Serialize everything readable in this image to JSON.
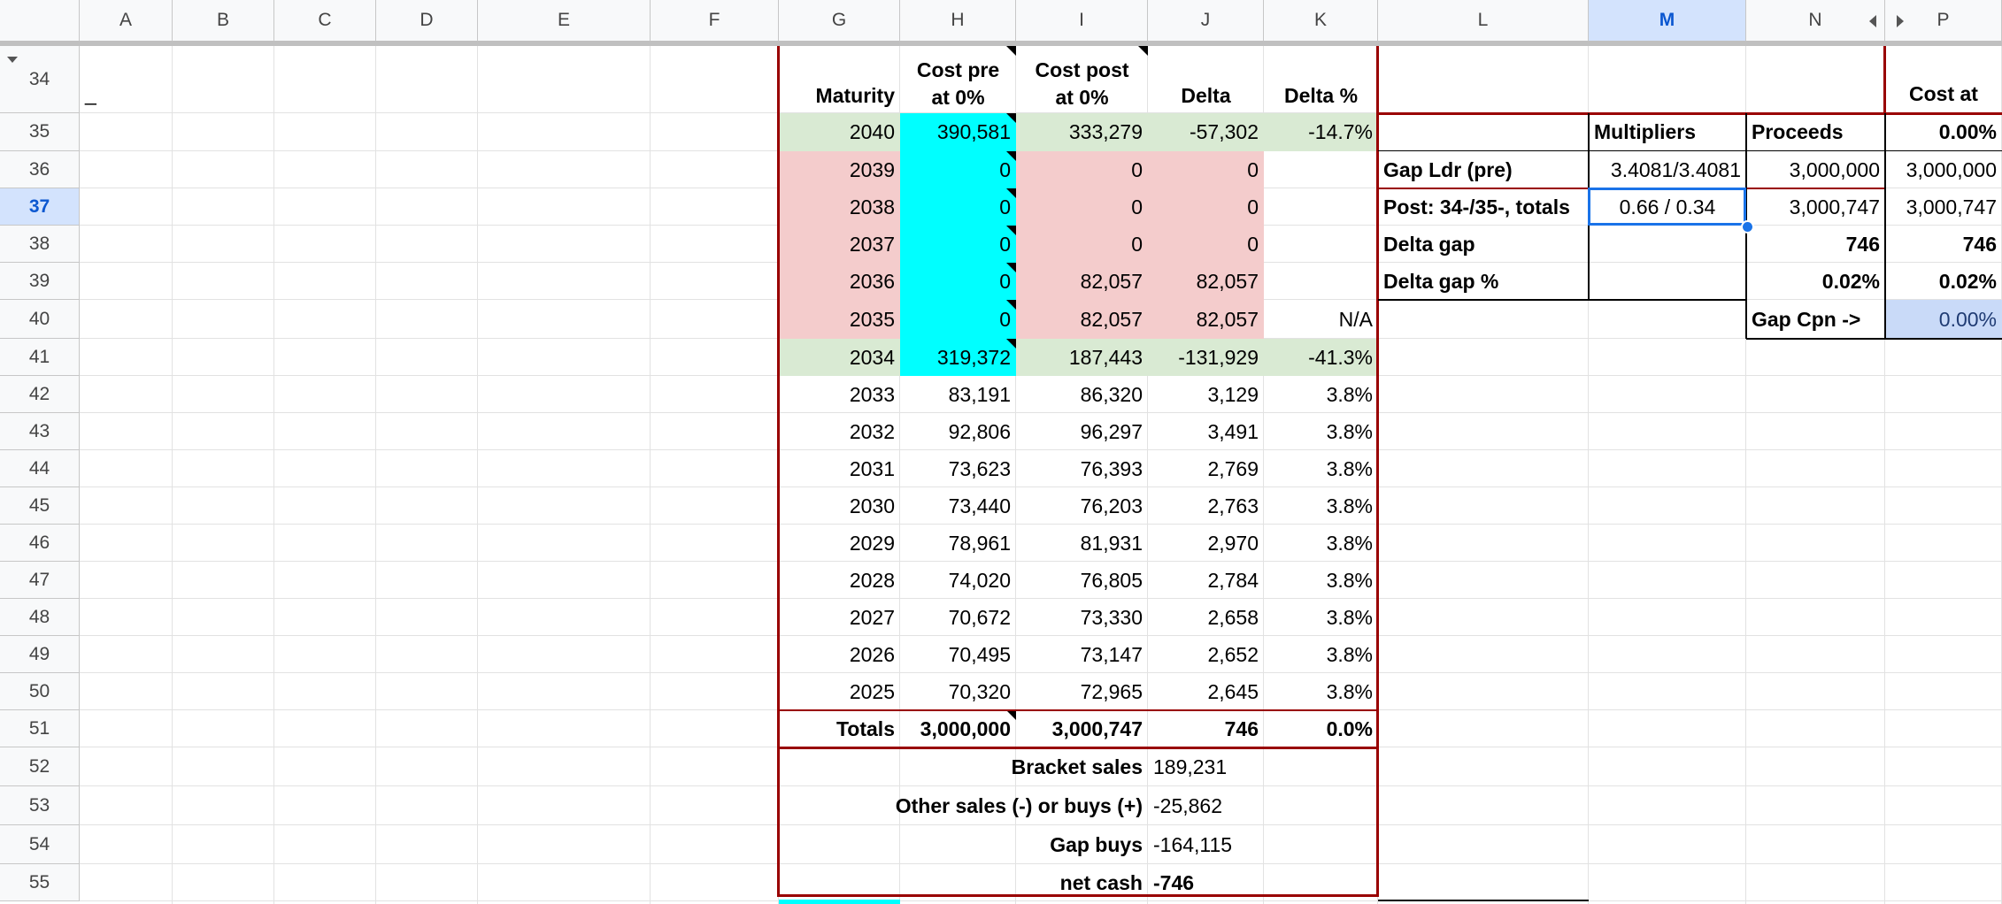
{
  "column_headers": [
    "A",
    "B",
    "C",
    "D",
    "E",
    "F",
    "G",
    "H",
    "I",
    "J",
    "K",
    "L",
    "M",
    "N",
    "P"
  ],
  "selected_column": "M",
  "row_numbers": [
    "34",
    "35",
    "36",
    "37",
    "38",
    "39",
    "40",
    "41",
    "42",
    "43",
    "44",
    "45",
    "46",
    "47",
    "48",
    "49",
    "50",
    "51",
    "52",
    "53",
    "54",
    "55"
  ],
  "selected_row": "37",
  "colors": {
    "green_fill": "#d9ead3",
    "pink_fill": "#f4cccc",
    "cyan_fill": "#00ffff",
    "border_red": "#990000",
    "selection_blue": "#1a73e8",
    "header_selected": "#d3e3fd",
    "light_blue_fill": "#c9daf8"
  },
  "header_row": {
    "maturity": "Maturity",
    "cost_pre_line1": "Cost pre",
    "cost_pre_line2": "at 0%",
    "cost_post_line1": "Cost post",
    "cost_post_line2": "at 0%",
    "delta": "Delta",
    "delta_pct": "Delta %",
    "cost_at": "Cost at",
    "stray_mark": "_"
  },
  "maturity_rows": [
    {
      "year": "2040",
      "pre": "390,581",
      "post": "333,279",
      "delta": "-57,302",
      "pct": "-14.7%"
    },
    {
      "year": "2039",
      "pre": "0",
      "post": "0",
      "delta": "0",
      "pct": ""
    },
    {
      "year": "2038",
      "pre": "0",
      "post": "0",
      "delta": "0",
      "pct": ""
    },
    {
      "year": "2037",
      "pre": "0",
      "post": "0",
      "delta": "0",
      "pct": ""
    },
    {
      "year": "2036",
      "pre": "0",
      "post": "82,057",
      "delta": "82,057",
      "pct": ""
    },
    {
      "year": "2035",
      "pre": "0",
      "post": "82,057",
      "delta": "82,057",
      "pct": "N/A"
    },
    {
      "year": "2034",
      "pre": "319,372",
      "post": "187,443",
      "delta": "-131,929",
      "pct": "-41.3%"
    },
    {
      "year": "2033",
      "pre": "83,191",
      "post": "86,320",
      "delta": "3,129",
      "pct": "3.8%"
    },
    {
      "year": "2032",
      "pre": "92,806",
      "post": "96,297",
      "delta": "3,491",
      "pct": "3.8%"
    },
    {
      "year": "2031",
      "pre": "73,623",
      "post": "76,393",
      "delta": "2,769",
      "pct": "3.8%"
    },
    {
      "year": "2030",
      "pre": "73,440",
      "post": "76,203",
      "delta": "2,763",
      "pct": "3.8%"
    },
    {
      "year": "2029",
      "pre": "78,961",
      "post": "81,931",
      "delta": "2,970",
      "pct": "3.8%"
    },
    {
      "year": "2028",
      "pre": "74,020",
      "post": "76,805",
      "delta": "2,784",
      "pct": "3.8%"
    },
    {
      "year": "2027",
      "pre": "70,672",
      "post": "73,330",
      "delta": "2,658",
      "pct": "3.8%"
    },
    {
      "year": "2026",
      "pre": "70,495",
      "post": "73,147",
      "delta": "2,652",
      "pct": "3.8%"
    },
    {
      "year": "2025",
      "pre": "70,320",
      "post": "72,965",
      "delta": "2,645",
      "pct": "3.8%"
    }
  ],
  "totals": {
    "label": "Totals",
    "pre": "3,000,000",
    "post": "3,000,747",
    "delta": "746",
    "pct": "0.0%"
  },
  "cash_rows": [
    {
      "label": "Bracket sales",
      "value": "189,231",
      "bold_value": false
    },
    {
      "label": "Other sales (-) or buys (+)",
      "value": "-25,862",
      "bold_value": false
    },
    {
      "label": "Gap buys",
      "value": "-164,115",
      "bold_value": false
    },
    {
      "label": "net cash",
      "value": "-746",
      "bold_value": true
    }
  ],
  "side_table": {
    "multipliers_header": "Multipliers",
    "proceeds_header": "Proceeds",
    "cost_pct": "0.00%",
    "rows": [
      {
        "label": "Gap Ldr (pre)",
        "mult": "3.4081/3.4081",
        "proceeds": "3,000,000",
        "cost": "3,000,000"
      },
      {
        "label": "Post: 34-/35-, totals",
        "mult": "0.66 / 0.34",
        "proceeds": "3,000,747",
        "cost": "3,000,747"
      },
      {
        "label": "Delta gap",
        "mult": "",
        "proceeds": "746",
        "cost": "746"
      },
      {
        "label": "Delta gap %",
        "mult": "",
        "proceeds": "0.02%",
        "cost": "0.02%"
      }
    ],
    "gap_cpn_label": "Gap Cpn ->",
    "gap_cpn_value": "0.00%"
  }
}
